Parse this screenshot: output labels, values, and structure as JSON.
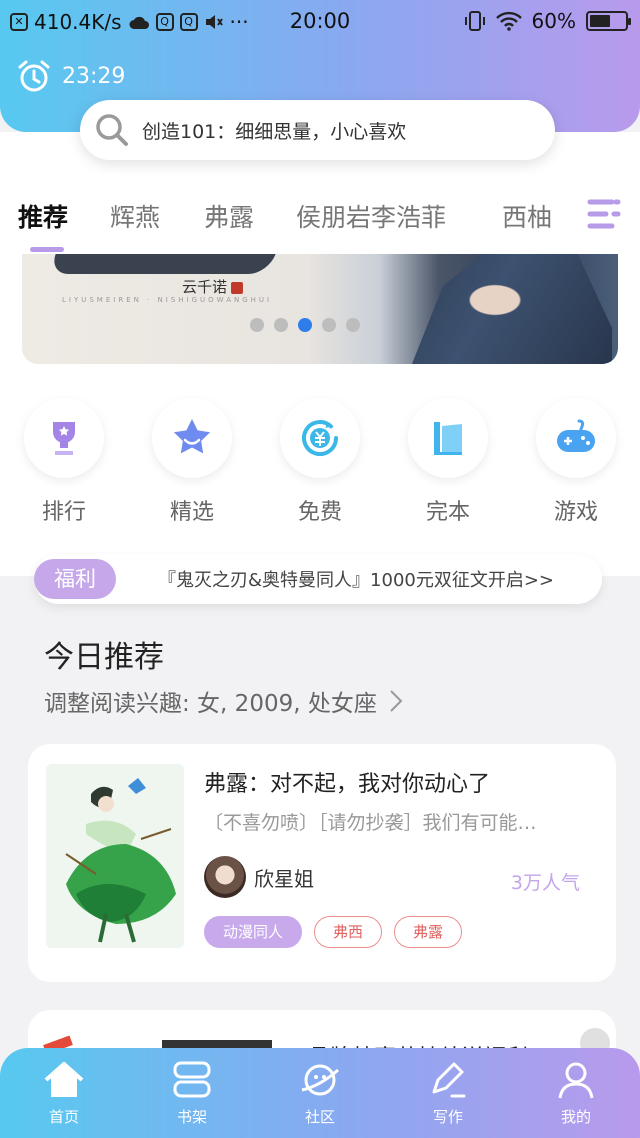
{
  "status_bar": {
    "speed": "410.4K/s",
    "time": "20:00",
    "battery": "60%",
    "battery_level": 0.6,
    "left_icons": [
      "x-icon",
      "cloud-icon",
      "qq-icon",
      "qq-icon",
      "mute-icon",
      "more-icon"
    ],
    "right_icons": [
      "vibrate-icon",
      "wifi-icon",
      "battery-icon"
    ]
  },
  "header": {
    "reading_time": "23:29",
    "search_placeholder": "创造101：细细思量，小心喜欢"
  },
  "tabs": [
    {
      "label": "推荐",
      "active": true
    },
    {
      "label": "辉燕",
      "active": false
    },
    {
      "label": "弗露",
      "active": false
    },
    {
      "label": "侯朋岩李浩菲",
      "active": false
    },
    {
      "label": "西柚",
      "active": false
    }
  ],
  "banner": {
    "author": "云千诺",
    "subtitle": "LIYUSMEIREN · NISHIGUOWANGHUI",
    "dots": 5,
    "active_dot": 2
  },
  "categories": [
    {
      "label": "排行",
      "icon": "trophy-icon",
      "color": "#a584e8"
    },
    {
      "label": "精选",
      "icon": "star-icon",
      "color": "#6f8bef"
    },
    {
      "label": "免费",
      "icon": "yuan-icon",
      "color": "#3bb7e8"
    },
    {
      "label": "完本",
      "icon": "book-icon",
      "color": "#41b4ee"
    },
    {
      "label": "游戏",
      "icon": "gamepad-icon",
      "color": "#4aa3f0"
    }
  ],
  "welfare": {
    "badge": "福利",
    "text": "『鬼灭之刃&奥特曼同人』1000元双征文开启>>"
  },
  "recommend": {
    "title": "今日推荐",
    "subtitle": "调整阅读兴趣: 女, 2009, 处女座",
    "book": {
      "title": "弗露：对不起，我对你动心了",
      "description": "〔不喜勿喷〕［请勿抄袭］我们有可能…",
      "author": "欣星姐",
      "popularity": "3万人气",
      "tags": [
        "动漫同人",
        "弗西",
        "弗露"
      ]
    },
    "next_book_title": "品牌特赛荐持续送福利"
  },
  "bottom_nav": [
    {
      "label": "首页",
      "icon": "home-icon",
      "active": true
    },
    {
      "label": "书架",
      "icon": "bookshelf-icon",
      "active": false
    },
    {
      "label": "社区",
      "icon": "planet-icon",
      "active": false
    },
    {
      "label": "写作",
      "icon": "pen-icon",
      "active": false
    },
    {
      "label": "我的",
      "icon": "user-icon",
      "active": false
    }
  ],
  "colors": {
    "gradient_start": "#57c9f0",
    "gradient_end": "#b99aec",
    "accent_purple": "#c6a8ea",
    "dot_active": "#2f7dea",
    "tag_red": "#e2625f"
  }
}
